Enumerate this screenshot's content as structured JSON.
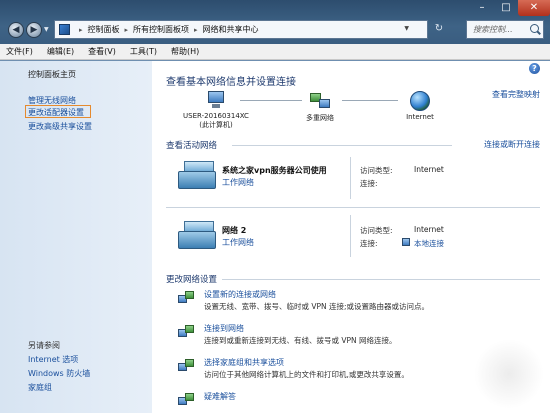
{
  "addressbar": {
    "crumbs": [
      "控制面板",
      "所有控制面板项",
      "网络和共享中心"
    ],
    "search_placeholder": "搜索控制..."
  },
  "menu": [
    "文件(F)",
    "编辑(E)",
    "查看(V)",
    "工具(T)",
    "帮助(H)"
  ],
  "sidebar": {
    "home": "控制面板主页",
    "wireless": "管理无线网络",
    "adapter": "更改适配器设置",
    "sharing": "更改高级共享设置",
    "see_also": "另请参阅",
    "internet_options": "Internet 选项",
    "firewall": "Windows 防火墙",
    "homegroup": "家庭组"
  },
  "main": {
    "title": "查看基本网络信息并设置连接",
    "view_full_map": "查看完整映射",
    "map": {
      "computer_name": "USER-20160314XC",
      "computer_sub": "(此计算机)",
      "network": "多重网络",
      "internet": "Internet"
    },
    "active_title": "查看活动网络",
    "connect_link": "连接或断开连接",
    "networks": [
      {
        "name": "系统之家vpn服务器公司使用",
        "type": "工作网络",
        "access_label": "访问类型:",
        "access_value": "Internet",
        "conn_label": "连接:",
        "conn_value": ""
      },
      {
        "name": "网络  2",
        "type": "工作网络",
        "access_label": "访问类型:",
        "access_value": "Internet",
        "conn_label": "连接:",
        "conn_value": "本地连接"
      }
    ],
    "change_title": "更改网络设置",
    "tasks": [
      {
        "link": "设置新的连接或网络",
        "desc": "设置无线、宽带、拨号、临时或 VPN 连接;或设置路由器或访问点。"
      },
      {
        "link": "连接到网络",
        "desc": "连接到或重新连接到无线、有线、拨号或 VPN 网络连接。"
      },
      {
        "link": "选择家庭组和共享选项",
        "desc": "访问位于其他网络计算机上的文件和打印机,或更改共享设置。"
      },
      {
        "link": "疑难解答",
        "desc": ""
      }
    ]
  }
}
